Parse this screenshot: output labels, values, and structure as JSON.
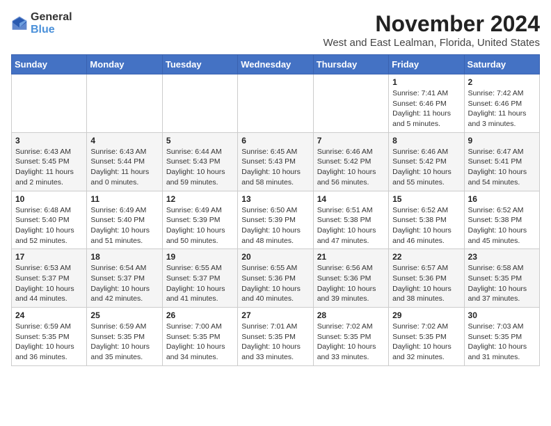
{
  "logo": {
    "general": "General",
    "blue": "Blue"
  },
  "header": {
    "month": "November 2024",
    "location": "West and East Lealman, Florida, United States"
  },
  "weekdays": [
    "Sunday",
    "Monday",
    "Tuesday",
    "Wednesday",
    "Thursday",
    "Friday",
    "Saturday"
  ],
  "weeks": [
    [
      {
        "day": "",
        "info": ""
      },
      {
        "day": "",
        "info": ""
      },
      {
        "day": "",
        "info": ""
      },
      {
        "day": "",
        "info": ""
      },
      {
        "day": "",
        "info": ""
      },
      {
        "day": "1",
        "info": "Sunrise: 7:41 AM\nSunset: 6:46 PM\nDaylight: 11 hours\nand 5 minutes."
      },
      {
        "day": "2",
        "info": "Sunrise: 7:42 AM\nSunset: 6:46 PM\nDaylight: 11 hours\nand 3 minutes."
      }
    ],
    [
      {
        "day": "3",
        "info": "Sunrise: 6:43 AM\nSunset: 5:45 PM\nDaylight: 11 hours\nand 2 minutes."
      },
      {
        "day": "4",
        "info": "Sunrise: 6:43 AM\nSunset: 5:44 PM\nDaylight: 11 hours\nand 0 minutes."
      },
      {
        "day": "5",
        "info": "Sunrise: 6:44 AM\nSunset: 5:43 PM\nDaylight: 10 hours\nand 59 minutes."
      },
      {
        "day": "6",
        "info": "Sunrise: 6:45 AM\nSunset: 5:43 PM\nDaylight: 10 hours\nand 58 minutes."
      },
      {
        "day": "7",
        "info": "Sunrise: 6:46 AM\nSunset: 5:42 PM\nDaylight: 10 hours\nand 56 minutes."
      },
      {
        "day": "8",
        "info": "Sunrise: 6:46 AM\nSunset: 5:42 PM\nDaylight: 10 hours\nand 55 minutes."
      },
      {
        "day": "9",
        "info": "Sunrise: 6:47 AM\nSunset: 5:41 PM\nDaylight: 10 hours\nand 54 minutes."
      }
    ],
    [
      {
        "day": "10",
        "info": "Sunrise: 6:48 AM\nSunset: 5:40 PM\nDaylight: 10 hours\nand 52 minutes."
      },
      {
        "day": "11",
        "info": "Sunrise: 6:49 AM\nSunset: 5:40 PM\nDaylight: 10 hours\nand 51 minutes."
      },
      {
        "day": "12",
        "info": "Sunrise: 6:49 AM\nSunset: 5:39 PM\nDaylight: 10 hours\nand 50 minutes."
      },
      {
        "day": "13",
        "info": "Sunrise: 6:50 AM\nSunset: 5:39 PM\nDaylight: 10 hours\nand 48 minutes."
      },
      {
        "day": "14",
        "info": "Sunrise: 6:51 AM\nSunset: 5:38 PM\nDaylight: 10 hours\nand 47 minutes."
      },
      {
        "day": "15",
        "info": "Sunrise: 6:52 AM\nSunset: 5:38 PM\nDaylight: 10 hours\nand 46 minutes."
      },
      {
        "day": "16",
        "info": "Sunrise: 6:52 AM\nSunset: 5:38 PM\nDaylight: 10 hours\nand 45 minutes."
      }
    ],
    [
      {
        "day": "17",
        "info": "Sunrise: 6:53 AM\nSunset: 5:37 PM\nDaylight: 10 hours\nand 44 minutes."
      },
      {
        "day": "18",
        "info": "Sunrise: 6:54 AM\nSunset: 5:37 PM\nDaylight: 10 hours\nand 42 minutes."
      },
      {
        "day": "19",
        "info": "Sunrise: 6:55 AM\nSunset: 5:37 PM\nDaylight: 10 hours\nand 41 minutes."
      },
      {
        "day": "20",
        "info": "Sunrise: 6:55 AM\nSunset: 5:36 PM\nDaylight: 10 hours\nand 40 minutes."
      },
      {
        "day": "21",
        "info": "Sunrise: 6:56 AM\nSunset: 5:36 PM\nDaylight: 10 hours\nand 39 minutes."
      },
      {
        "day": "22",
        "info": "Sunrise: 6:57 AM\nSunset: 5:36 PM\nDaylight: 10 hours\nand 38 minutes."
      },
      {
        "day": "23",
        "info": "Sunrise: 6:58 AM\nSunset: 5:35 PM\nDaylight: 10 hours\nand 37 minutes."
      }
    ],
    [
      {
        "day": "24",
        "info": "Sunrise: 6:59 AM\nSunset: 5:35 PM\nDaylight: 10 hours\nand 36 minutes."
      },
      {
        "day": "25",
        "info": "Sunrise: 6:59 AM\nSunset: 5:35 PM\nDaylight: 10 hours\nand 35 minutes."
      },
      {
        "day": "26",
        "info": "Sunrise: 7:00 AM\nSunset: 5:35 PM\nDaylight: 10 hours\nand 34 minutes."
      },
      {
        "day": "27",
        "info": "Sunrise: 7:01 AM\nSunset: 5:35 PM\nDaylight: 10 hours\nand 33 minutes."
      },
      {
        "day": "28",
        "info": "Sunrise: 7:02 AM\nSunset: 5:35 PM\nDaylight: 10 hours\nand 33 minutes."
      },
      {
        "day": "29",
        "info": "Sunrise: 7:02 AM\nSunset: 5:35 PM\nDaylight: 10 hours\nand 32 minutes."
      },
      {
        "day": "30",
        "info": "Sunrise: 7:03 AM\nSunset: 5:35 PM\nDaylight: 10 hours\nand 31 minutes."
      }
    ]
  ]
}
